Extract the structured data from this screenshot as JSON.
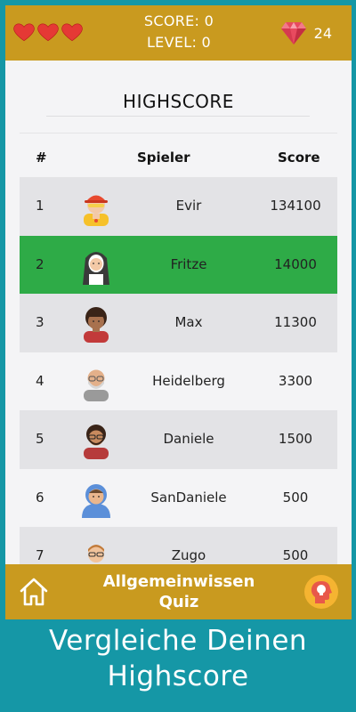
{
  "header": {
    "lives": 3,
    "score_label": "SCORE: 0",
    "level_label": "LEVEL: 0",
    "gems": "24",
    "heart_icon": "heart-icon",
    "gem_icon": "diamond-icon",
    "bar_color": "#c99a1f"
  },
  "page": {
    "title": "HIGHSCORE"
  },
  "table": {
    "columns": [
      "#",
      "Spieler",
      "Score"
    ],
    "highlight_color": "#2eab47",
    "rows": [
      {
        "rank": "1",
        "name": "Evir",
        "score": "134100",
        "avatar": "firefighter-avatar"
      },
      {
        "rank": "2",
        "name": "Fritze",
        "score": "14000",
        "avatar": "nun-avatar"
      },
      {
        "rank": "3",
        "name": "Max",
        "score": "11300",
        "avatar": "curly-hair-man-avatar"
      },
      {
        "rank": "4",
        "name": "Heidelberg",
        "score": "3300",
        "avatar": "bald-bearded-man-avatar"
      },
      {
        "rank": "5",
        "name": "Daniele",
        "score": "1500",
        "avatar": "bearded-man-avatar"
      },
      {
        "rank": "6",
        "name": "SanDaniele",
        "score": "500",
        "avatar": "hoodie-man-avatar"
      },
      {
        "rank": "7",
        "name": "Zugo",
        "score": "500",
        "avatar": "boy-glasses-avatar"
      }
    ]
  },
  "footer": {
    "app_name_line1": "Allgemeinwissen",
    "app_name_line2": "Quiz",
    "home_icon": "home-icon",
    "idea_icon": "lightbulb-head-icon"
  },
  "caption": {
    "line1": "Vergleiche Deinen",
    "line2": "Highscore"
  }
}
